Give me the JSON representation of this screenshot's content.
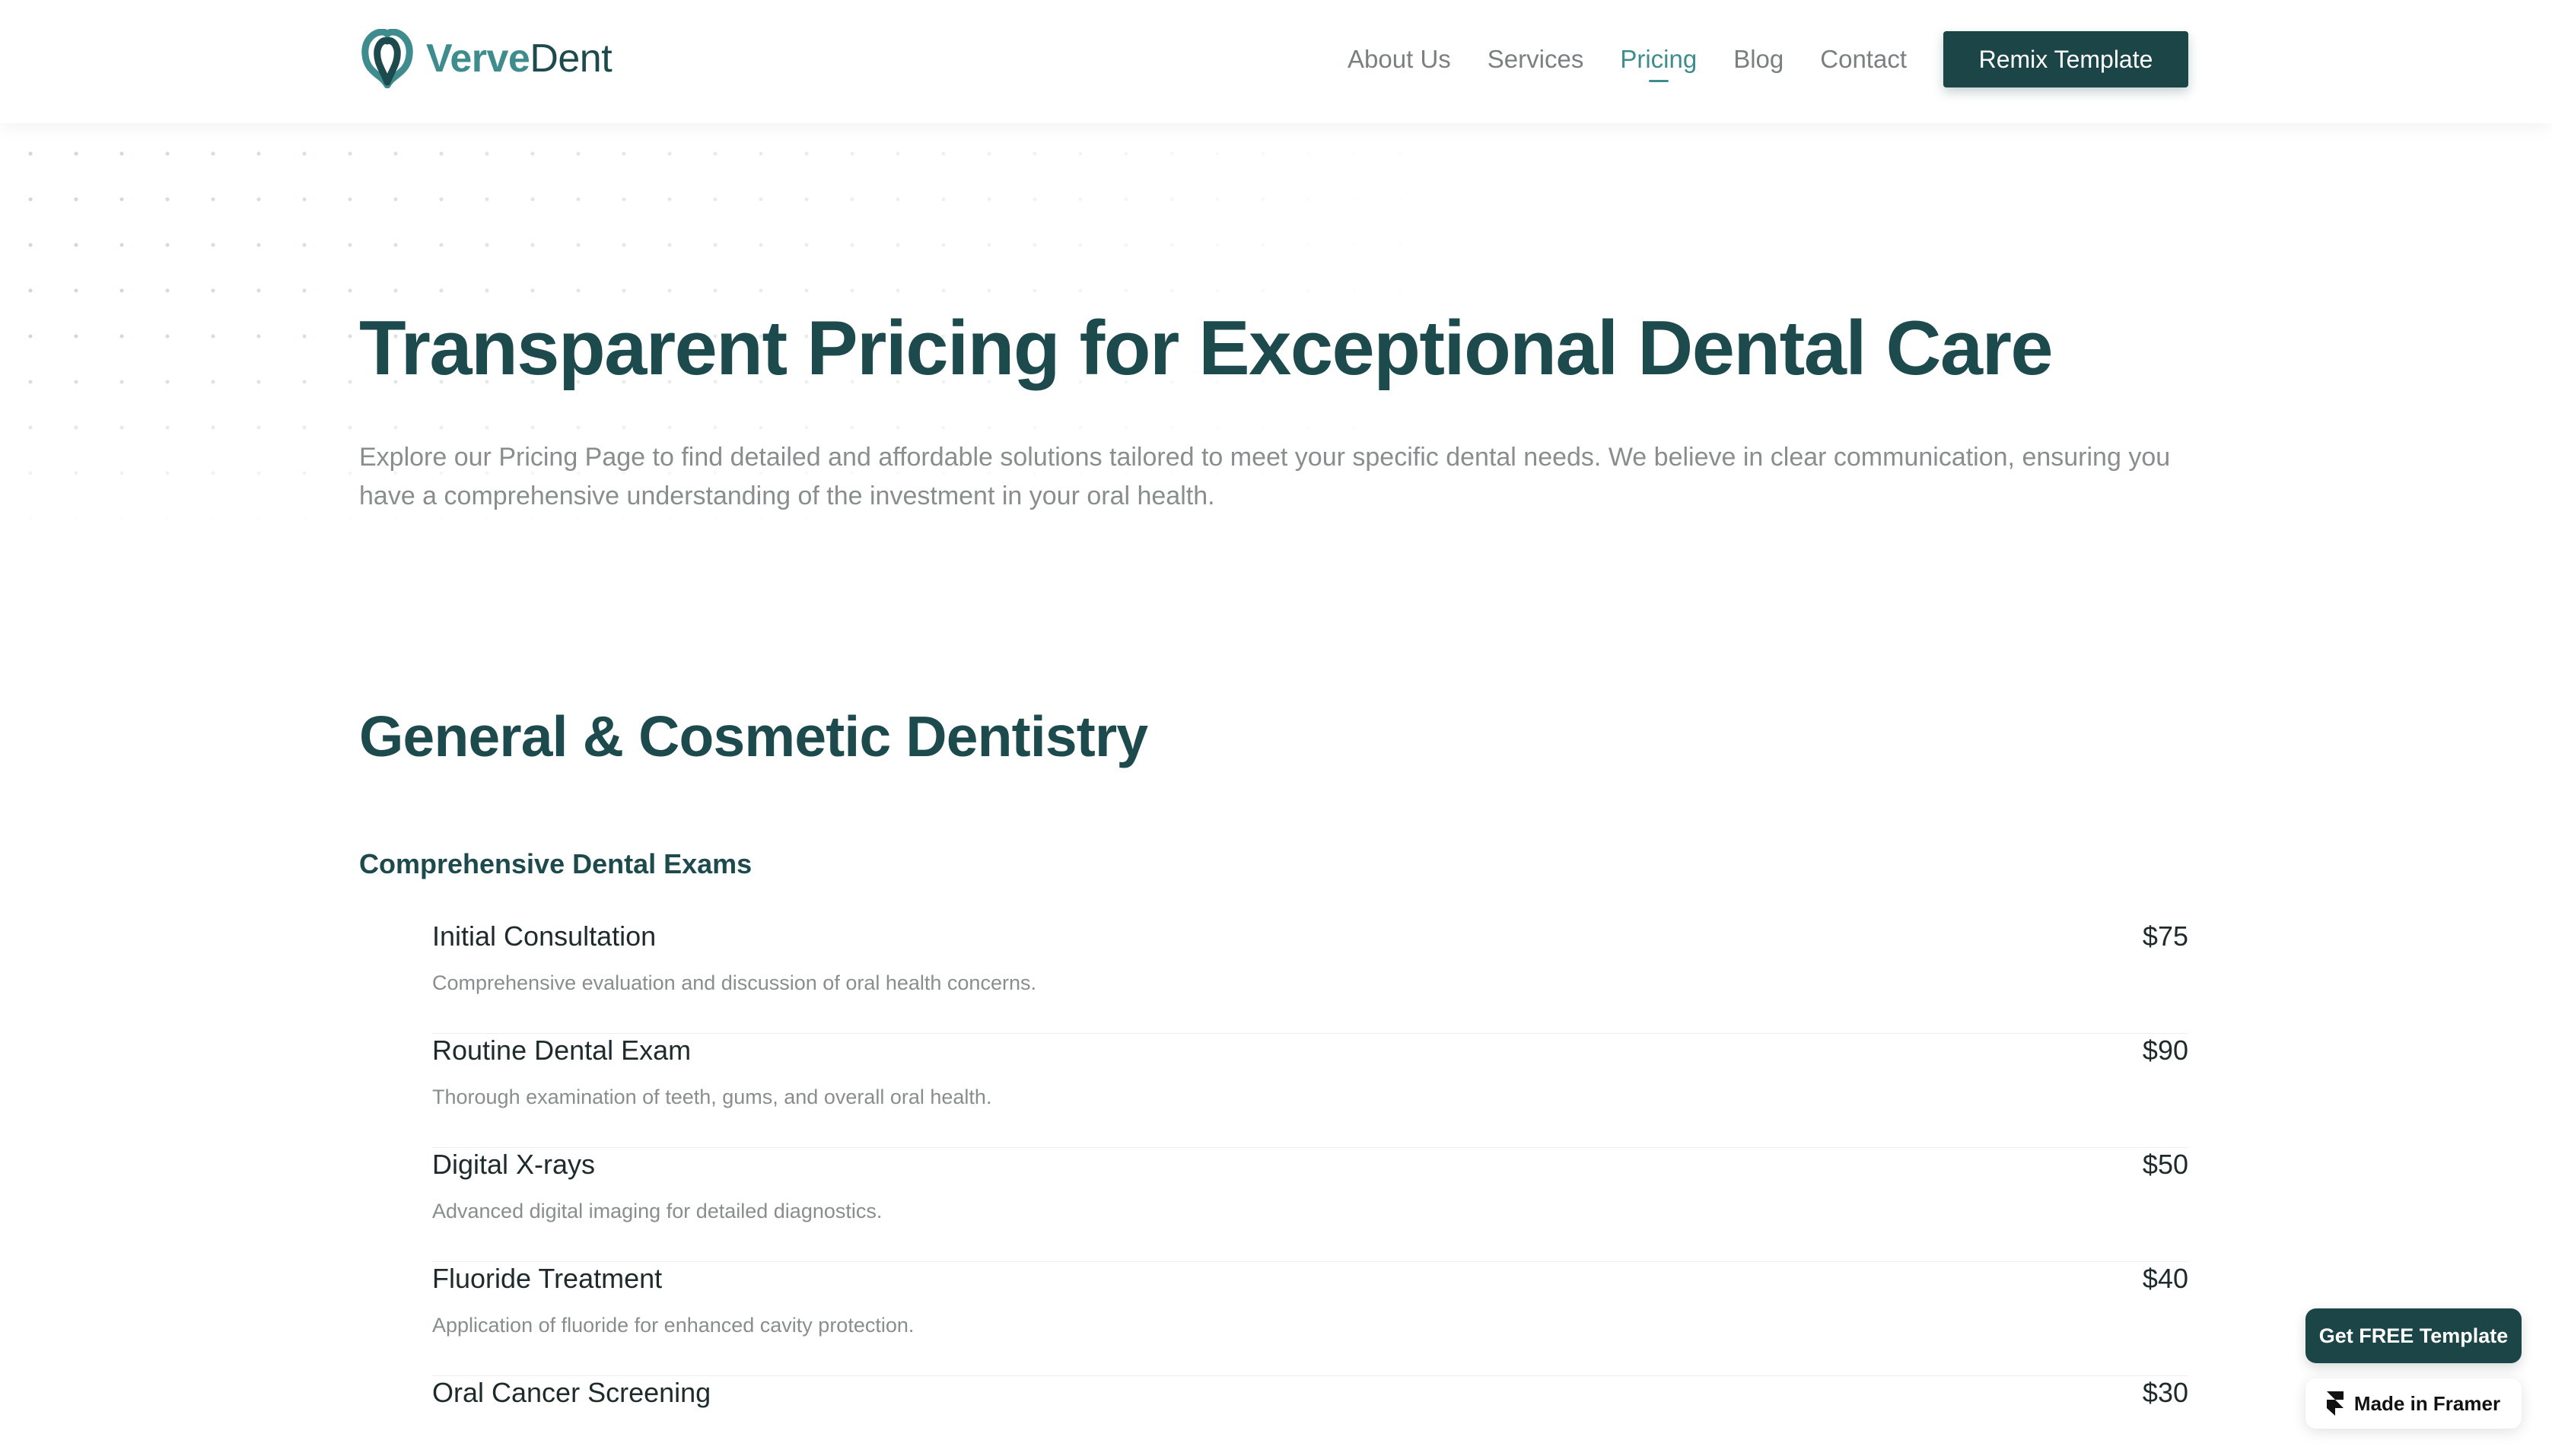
{
  "header": {
    "logo": {
      "part1": "Verve",
      "part2": "Dent"
    },
    "nav": [
      {
        "label": "About Us",
        "active": false
      },
      {
        "label": "Services",
        "active": false
      },
      {
        "label": "Pricing",
        "active": true
      },
      {
        "label": "Blog",
        "active": false
      },
      {
        "label": "Contact",
        "active": false
      }
    ],
    "cta_label": "Remix Template"
  },
  "hero": {
    "title": "Transparent Pricing for Exceptional Dental Care",
    "description": "Explore our Pricing Page to find detailed and affordable solutions tailored to meet your specific dental needs. We believe in clear communication, ensuring you have a comprehensive understanding of the investment in your oral health."
  },
  "section": {
    "title": "General & Cosmetic Dentistry",
    "subtitle": "Comprehensive Dental Exams",
    "items": [
      {
        "name": "Initial Consultation",
        "price": "$75",
        "desc": "Comprehensive evaluation and discussion of oral health concerns."
      },
      {
        "name": "Routine Dental Exam",
        "price": "$90",
        "desc": "Thorough examination of teeth, gums, and overall oral health."
      },
      {
        "name": "Digital X-rays",
        "price": "$50",
        "desc": "Advanced digital imaging for detailed diagnostics."
      },
      {
        "name": "Fluoride Treatment",
        "price": "$40",
        "desc": "Application of fluoride for enhanced cavity protection."
      },
      {
        "name": "Oral Cancer Screening",
        "price": "$30",
        "desc": ""
      }
    ]
  },
  "floating": {
    "template_label": "Get FREE Template",
    "framer_label": "Made in Framer"
  },
  "colors": {
    "brand_dark": "#1c4547",
    "brand_accent": "#3f8c8e",
    "muted_text": "#8a8d8e"
  },
  "icons": [
    "tooth-logo-icon",
    "framer-icon"
  ]
}
